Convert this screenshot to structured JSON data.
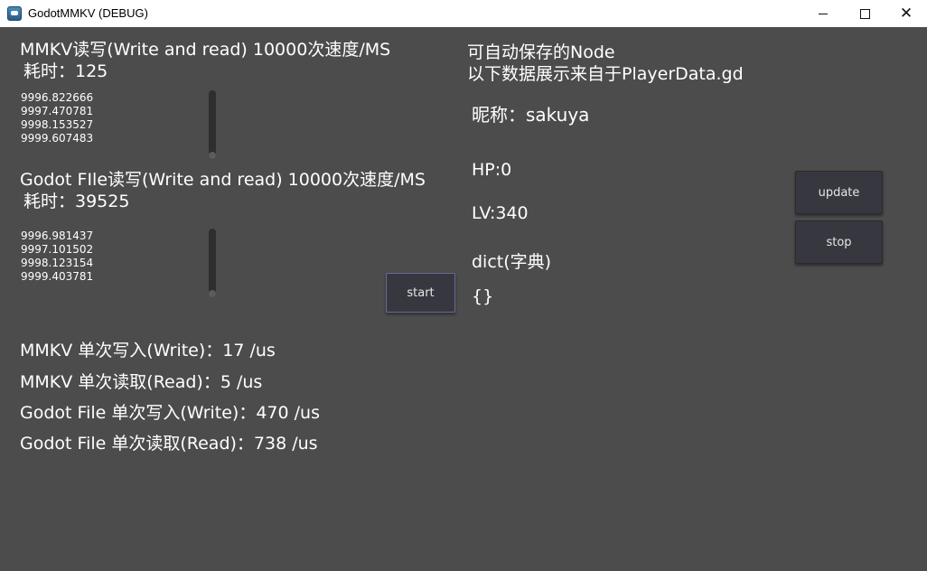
{
  "window": {
    "title": "GodotMMKV (DEBUG)",
    "controls": {
      "minimize": "—",
      "maximize": "☐",
      "close": "✕"
    }
  },
  "mmkv": {
    "header": "MMKV读写(Write and read) 10000次速度/MS",
    "elapsed": "耗时：125",
    "values": [
      "9996.822666",
      "9997.470781",
      "9998.153527",
      "9999.607483"
    ]
  },
  "godot_file": {
    "header": "Godot FIle读写(Write and read) 10000次速度/MS",
    "elapsed": "耗时：39525",
    "values": [
      "9996.981437",
      "9997.101502",
      "9998.123154",
      "9999.403781"
    ]
  },
  "buttons": {
    "start": "start",
    "update": "update",
    "stop": "stop"
  },
  "single_ops": [
    "MMKV 单次写入(Write)：17 /us",
    "MMKV 单次读取(Read)：5 /us",
    "Godot File 单次写入(Write)：470 /us",
    "Godot File 单次读取(Read)：738 /us"
  ],
  "node": {
    "title": "可自动保存的Node",
    "subtitle": "以下数据展示来自于PlayerData.gd",
    "nickname": "昵称：sakuya",
    "hp": "HP:0",
    "lv": "LV:340",
    "dict_label": "dict(字典)",
    "dict_value": "{}"
  },
  "colors": {
    "background": "#4c4c4c",
    "titlebar": "#ffffff",
    "button": "#37373f",
    "scrollbar": "#2e2e2e"
  }
}
